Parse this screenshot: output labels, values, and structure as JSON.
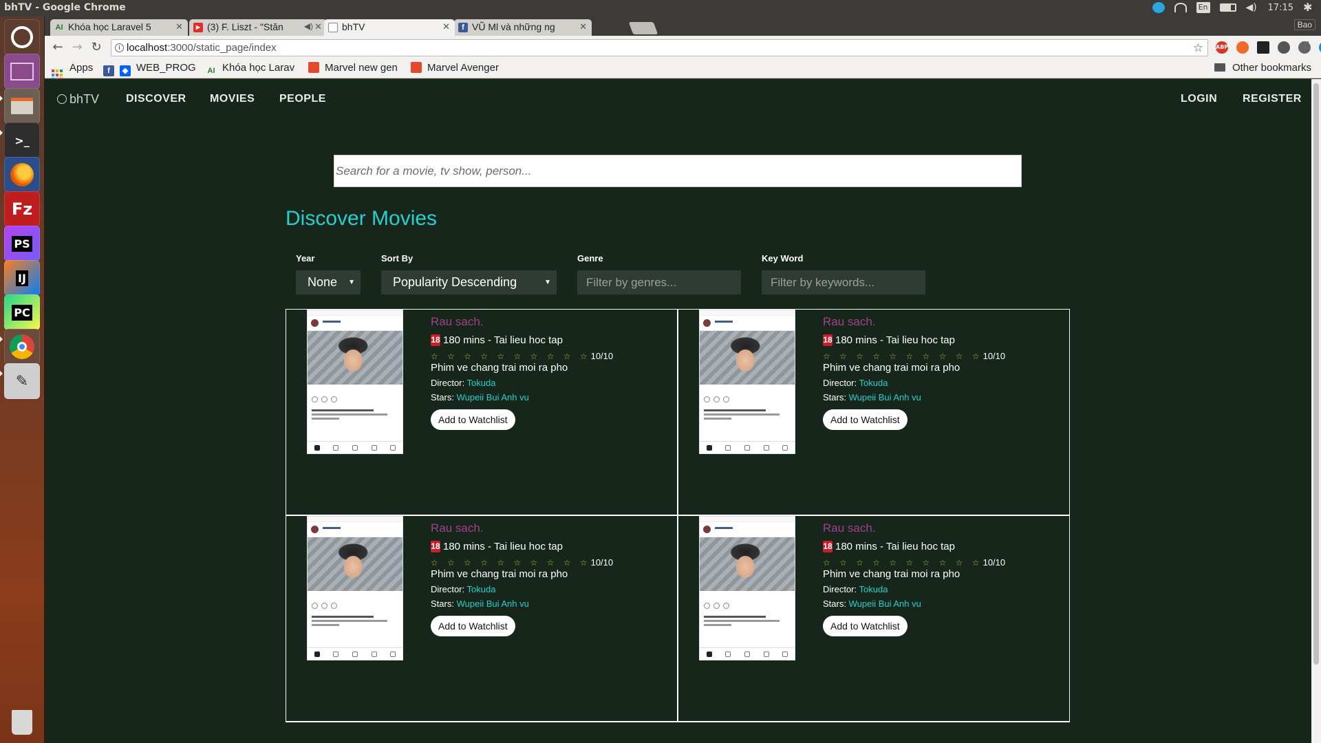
{
  "os": {
    "window_title": "bhTV - Google Chrome",
    "lang": "En",
    "clock": "17:15"
  },
  "browser": {
    "tabs": [
      {
        "title": "Khóa học Laravel 5",
        "favicon": "AI"
      },
      {
        "title": "(3) F. Liszt - \"Stăn",
        "favicon": "▶"
      },
      {
        "title": "bhTV",
        "favicon": ""
      },
      {
        "title": "VŨ Ml và những ng",
        "favicon": "f"
      }
    ],
    "profile": "Bao",
    "url_host": "localhost",
    "url_path": ":3000/static_page/index",
    "bookmarks": [
      "Apps",
      "WEB_PROG",
      "Khóa học Larav",
      "Marvel new gen",
      "Marvel Avenger"
    ],
    "other_bookmarks": "Other bookmarks"
  },
  "site": {
    "brand": "bhTV",
    "nav": [
      "DISCOVER",
      "MOVIES",
      "PEOPLE"
    ],
    "login": "LOGIN",
    "register": "REGISTER",
    "search_placeholder": "Search for a movie, tv show, person...",
    "heading": "Discover Movies",
    "filters": {
      "year_label": "Year",
      "year_value": "None",
      "sort_label": "Sort By",
      "sort_value": "Popularity Descending",
      "genre_label": "Genre",
      "genre_placeholder": "Filter by genres...",
      "keyword_label": "Key Word",
      "keyword_placeholder": "Filter by keywords..."
    }
  },
  "movies": [
    {
      "title": "Rau sach.",
      "age": "18",
      "meta": "180 mins - Tai lieu hoc tap",
      "stars": "☆ ☆ ☆ ☆ ☆ ☆ ☆ ☆ ☆ ☆",
      "score": "10/10",
      "plot": "Phim ve chang trai moi ra pho",
      "director_label": "Director:",
      "director": "Tokuda",
      "stars_label": "Stars:",
      "cast": "Wupeii Bui Anh vu",
      "button": "Add to Watchlist"
    },
    {
      "title": "Rau sach.",
      "age": "18",
      "meta": "180 mins - Tai lieu hoc tap",
      "stars": "☆ ☆ ☆ ☆ ☆ ☆ ☆ ☆ ☆ ☆",
      "score": "10/10",
      "plot": "Phim ve chang trai moi ra pho",
      "director_label": "Director:",
      "director": "Tokuda",
      "stars_label": "Stars:",
      "cast": "Wupeii Bui Anh vu",
      "button": "Add to Watchlist"
    },
    {
      "title": "Rau sach.",
      "age": "18",
      "meta": "180 mins - Tai lieu hoc tap",
      "stars": "☆ ☆ ☆ ☆ ☆ ☆ ☆ ☆ ☆ ☆",
      "score": "10/10",
      "plot": "Phim ve chang trai moi ra pho",
      "director_label": "Director:",
      "director": "Tokuda",
      "stars_label": "Stars:",
      "cast": "Wupeii Bui Anh vu",
      "button": "Add to Watchlist"
    },
    {
      "title": "Rau sach.",
      "age": "18",
      "meta": "180 mins - Tai lieu hoc tap",
      "stars": "☆ ☆ ☆ ☆ ☆ ☆ ☆ ☆ ☆ ☆",
      "score": "10/10",
      "plot": "Phim ve chang trai moi ra pho",
      "director_label": "Director:",
      "director": "Tokuda",
      "stars_label": "Stars:",
      "cast": "Wupeii Bui Anh vu",
      "button": "Add to Watchlist"
    }
  ],
  "colors": {
    "page_bg": "#16261a",
    "accent_cyan": "#27d0d0",
    "title_purple": "#a0408d",
    "rating_red": "#c81e2a"
  }
}
